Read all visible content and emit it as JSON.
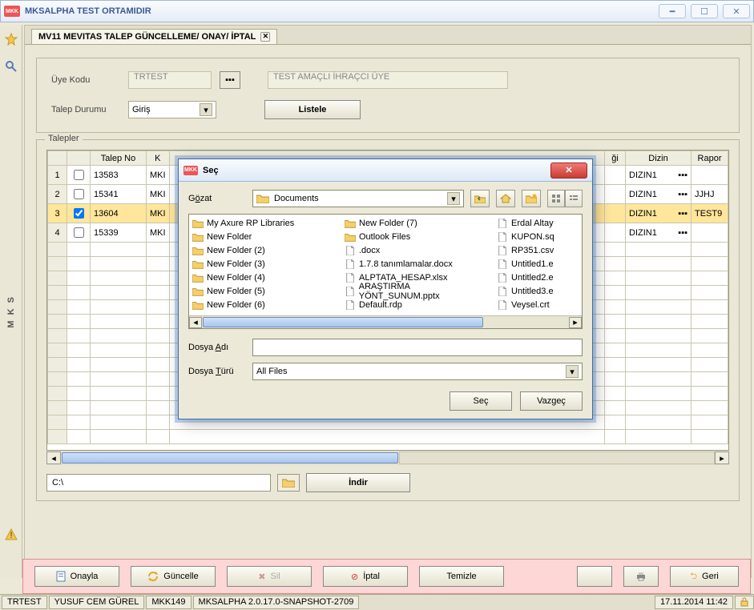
{
  "window": {
    "title": "MKSALPHA TEST ORTAMIDIR"
  },
  "tab": {
    "label": "MV11 MEVITAS TALEP GÜNCELLEME/ ONAY/ İPTAL"
  },
  "filter": {
    "uye_kodu_label": "Üye Kodu",
    "uye_kodu_value": "TRTEST",
    "uye_desc": "TEST AMAÇLI İHRAÇCI ÜYE",
    "talep_durumu_label": "Talep Durumu",
    "talep_durumu_value": "Giriş",
    "listele": "Listele"
  },
  "talepler": {
    "legend": "Talepler",
    "headers": {
      "talep_no": "Talep No",
      "k": "K",
      "gi": "ği",
      "dizin": "Dizin",
      "rapor": "Rapor"
    },
    "rows": [
      {
        "n": "1",
        "chk": false,
        "talep": "13583",
        "k": "MKI",
        "dizin": "DIZIN1",
        "rapor": "",
        "sel": false
      },
      {
        "n": "2",
        "chk": false,
        "talep": "15341",
        "k": "MKI",
        "dizin": "DIZIN1",
        "rapor": "JJHJ",
        "sel": false
      },
      {
        "n": "3",
        "chk": true,
        "talep": "13604",
        "k": "MKI",
        "dizin": "DIZIN1",
        "rapor": "TEST9",
        "sel": true
      },
      {
        "n": "4",
        "chk": false,
        "talep": "15339",
        "k": "MKI",
        "dizin": "DIZIN1",
        "rapor": "",
        "sel": false
      }
    ],
    "download_path": "C:\\",
    "indir": "İndir"
  },
  "actions": {
    "onayla": "Onayla",
    "guncelle": "Güncelle",
    "sil": "Sil",
    "iptal": "İptal",
    "temizle": "Temizle",
    "geri": "Geri"
  },
  "status": {
    "user_code": "TRTEST",
    "user_name": "YUSUF CEM GÜREL",
    "branch": "MKK149",
    "version": "MKSALPHA 2.0.17.0-SNAPSHOT-2709",
    "datetime": "17.11.2014 11:42"
  },
  "sidebar": {
    "label": "M K S"
  },
  "dialog": {
    "title": "Seç",
    "gozat_label": "Gözat",
    "location": "Documents",
    "dosya_adi_label": "Dosya Adı",
    "dosya_adi_value": "",
    "dosya_turu_label": "Dosya Türü",
    "dosya_turu_value": "All Files",
    "sec": "Seç",
    "vazgec": "Vazgeç",
    "cols": [
      [
        {
          "t": "folder",
          "n": "My Axure RP Libraries"
        },
        {
          "t": "folder",
          "n": "New Folder"
        },
        {
          "t": "folder",
          "n": "New Folder (2)"
        },
        {
          "t": "folder",
          "n": "New Folder (3)"
        },
        {
          "t": "folder",
          "n": "New Folder (4)"
        },
        {
          "t": "folder",
          "n": "New Folder (5)"
        },
        {
          "t": "folder",
          "n": "New Folder (6)"
        }
      ],
      [
        {
          "t": "folder",
          "n": "New Folder (7)"
        },
        {
          "t": "folder",
          "n": "Outlook Files"
        },
        {
          "t": "file",
          "n": ".docx"
        },
        {
          "t": "file",
          "n": "1.7.8 tanımlamalar.docx"
        },
        {
          "t": "file",
          "n": "ALPTATA_HESAP.xlsx"
        },
        {
          "t": "file",
          "n": "ARAŞTIRMA YÖNT_SUNUM.pptx"
        },
        {
          "t": "file",
          "n": "Default.rdp"
        }
      ],
      [
        {
          "t": "file",
          "n": "Erdal Altay"
        },
        {
          "t": "file",
          "n": "KUPON.sq"
        },
        {
          "t": "file",
          "n": "RP351.csv"
        },
        {
          "t": "file",
          "n": "Untitled1.e"
        },
        {
          "t": "file",
          "n": "Untitled2.e"
        },
        {
          "t": "file",
          "n": "Untitled3.e"
        },
        {
          "t": "file",
          "n": "Veysel.crt"
        }
      ]
    ]
  }
}
